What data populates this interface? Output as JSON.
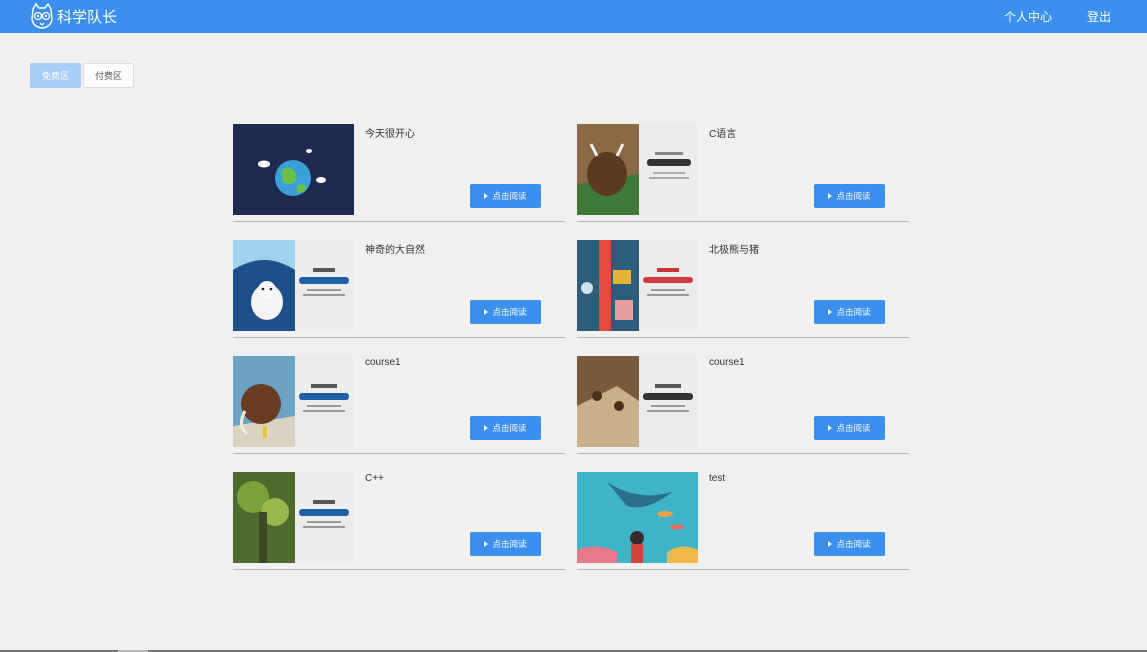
{
  "header": {
    "logo_text": "科学队长",
    "nav": {
      "profile": "个人中心",
      "logout": "登出"
    }
  },
  "tabs": {
    "free": "免费区",
    "paid": "付费区"
  },
  "colors": {
    "primary": "#3b8fee",
    "tab_active": "#a8cdf8",
    "background": "#f0f0f0"
  },
  "courses": [
    {
      "title": "今天很开心",
      "button": "点击阅读",
      "cover": "earth-illustration"
    },
    {
      "title": "C语言",
      "button": "点击阅读",
      "cover": "yak-cover"
    },
    {
      "title": "神奇的大自然",
      "button": "点击阅读",
      "cover": "polar-bear-cover"
    },
    {
      "title": "北极熊与猪",
      "button": "点击阅读",
      "cover": "thermometer-cover"
    },
    {
      "title": "course1",
      "button": "点击阅读",
      "cover": "mammoth-cover"
    },
    {
      "title": "course1",
      "button": "点击阅读",
      "cover": "ancient-humans-cover"
    },
    {
      "title": "C++",
      "button": "点击阅读",
      "cover": "forest-cover"
    },
    {
      "title": "test",
      "button": "点击阅读",
      "cover": "underwater-cover"
    }
  ]
}
